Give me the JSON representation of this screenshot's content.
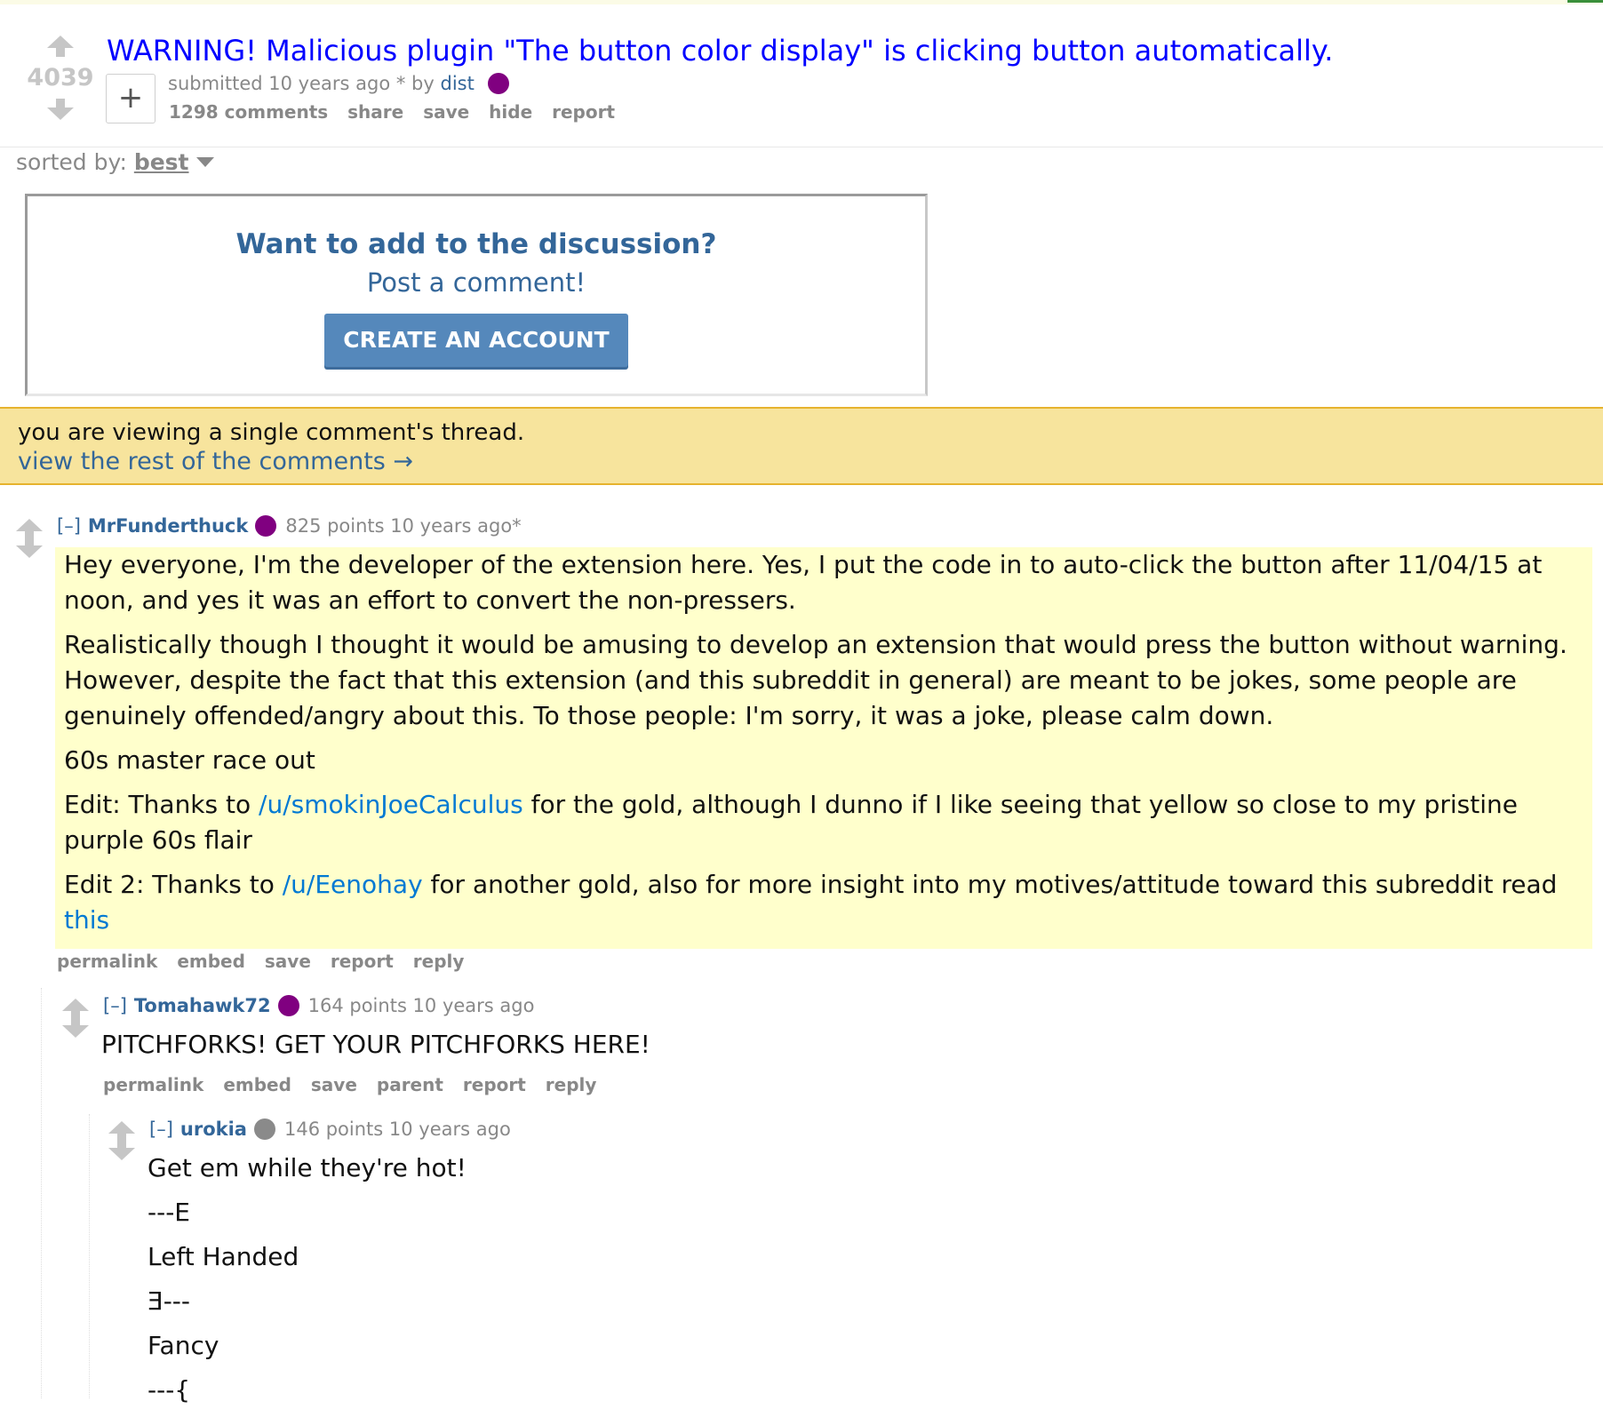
{
  "post": {
    "score": "4039",
    "title": "WARNING! Malicious plugin \"The button color display\" is clicking button automatically.",
    "expand_symbol": "+",
    "submitted_prefix": "submitted 10 years ago * by",
    "author": "dist",
    "links": [
      "1298 comments",
      "share",
      "save",
      "hide",
      "report"
    ]
  },
  "sort": {
    "label": "sorted by:",
    "value": "best"
  },
  "cta": {
    "heading": "Want to add to the discussion?",
    "subheading": "Post a comment!",
    "button": "CREATE AN ACCOUNT"
  },
  "thread_banner": {
    "line1": "you are viewing a single comment's thread.",
    "line2": "view the rest of the comments →"
  },
  "comments": [
    {
      "collapse": "[–]",
      "author": "MrFunderthuck",
      "flair_color": "#800080",
      "meta": "825 points 10 years ago*",
      "paragraphs": {
        "p1": "Hey everyone, I'm the developer of the extension here. Yes, I put the code in to auto-click the button after 11/04/15 at noon, and yes it was an effort to convert the non-pressers.",
        "p2": "Realistically though I thought it would be amusing to develop an extension that would press the button without warning. However, despite the fact that this extension (and this subreddit in general) are meant to be jokes, some people are genuinely offended/angry about this. To those people: I'm sorry, it was a joke, please calm down.",
        "p3": "60s master race out",
        "p4_a": "Edit: Thanks to ",
        "p4_link": "/u/smokinJoeCalculus",
        "p4_b": " for the gold, although I dunno if I like seeing that yellow so close to my pristine purple 60s flair",
        "p5_a": "Edit 2: Thanks to ",
        "p5_link": "/u/Eenohay",
        "p5_b": " for another gold, also for more insight into my motives/attitude toward this subreddit read ",
        "p5_link2": "this"
      },
      "links": [
        "permalink",
        "embed",
        "save",
        "report",
        "reply"
      ]
    },
    {
      "collapse": "[–]",
      "author": "Tomahawk72",
      "flair_color": "#800080",
      "meta": "164 points 10 years ago",
      "body": "PITCHFORKS! GET YOUR PITCHFORKS HERE!",
      "links": [
        "permalink",
        "embed",
        "save",
        "parent",
        "report",
        "reply"
      ]
    },
    {
      "collapse": "[–]",
      "author": "urokia",
      "flair_color": "#8a8a8a",
      "meta": "146 points 10 years ago",
      "lines": [
        "Get em while they're hot!",
        "---E",
        "Left Handed",
        "Ǝ---",
        "Fancy",
        "---{"
      ]
    }
  ]
}
